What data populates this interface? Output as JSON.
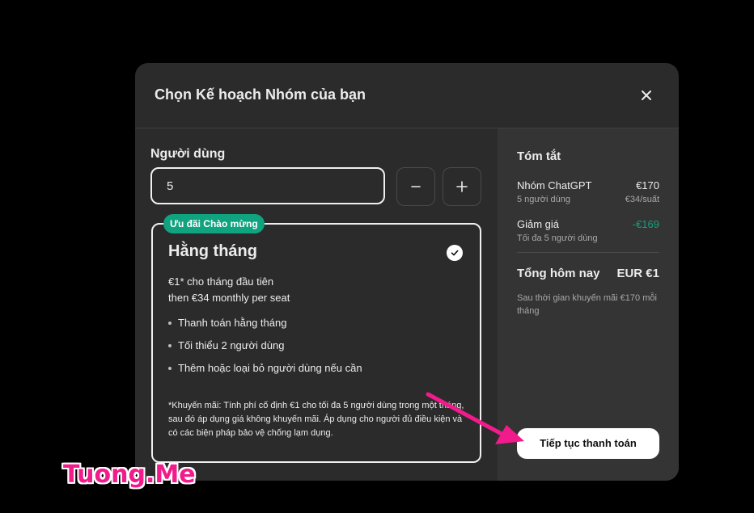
{
  "modal": {
    "title": "Chọn Kế hoạch Nhóm của bạn"
  },
  "users": {
    "label": "Người dùng",
    "value": "5"
  },
  "plan": {
    "badge": "Ưu đãi Chào mừng",
    "name": "Hằng tháng",
    "price_line_1": "€1* cho tháng đầu tiên",
    "price_line_2": "then €34 monthly per seat",
    "features": [
      "Thanh toán hằng tháng",
      "Tối thiểu 2 người dùng",
      "Thêm hoặc loại bỏ người dùng nếu cần"
    ],
    "disclaimer": "*Khuyến mãi: Tính phí cố định €1 cho tối đa 5 người dùng trong một tháng, sau đó áp dụng giá không khuyến mãi. Áp dụng cho người đủ điều kiện và có các biện pháp bảo vệ chống lạm dụng."
  },
  "summary": {
    "title": "Tóm tắt",
    "item_name": "Nhóm ChatGPT",
    "item_price": "€170",
    "item_users": "5 người dùng",
    "item_rate": "€34/suất",
    "discount_label": "Giảm giá",
    "discount_value": "-€169",
    "discount_note": "Tối đa 5 người dùng",
    "total_label": "Tổng hôm nay",
    "total_value": "EUR €1",
    "after_promo": "Sau thời gian khuyến mãi €170 mỗi tháng",
    "checkout_label": "Tiếp tục thanh toán"
  },
  "watermark": "Tuong.Me",
  "colors": {
    "accent_green": "#10a37f",
    "arrow_pink": "#f21b8b",
    "modal_bg": "#2b2b2b",
    "summary_bg": "#343434"
  },
  "icons": [
    "close-icon",
    "minus-icon",
    "plus-icon",
    "check-circle-icon",
    "annotation-arrow-icon"
  ]
}
